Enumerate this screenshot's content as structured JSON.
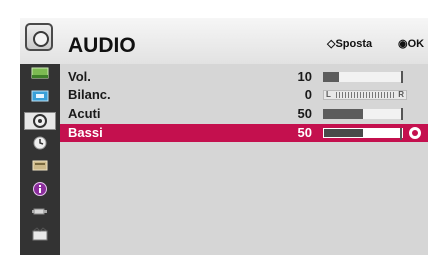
{
  "header": {
    "title": "AUDIO",
    "hint_move": "◇Sposta",
    "hint_ok": "◉OK",
    "icon": "audio-icon"
  },
  "sidebar": {
    "items": [
      {
        "icon": "picture-icon"
      },
      {
        "icon": "screen-icon"
      },
      {
        "icon": "audio-icon",
        "active": true
      },
      {
        "icon": "time-icon"
      },
      {
        "icon": "setup-icon"
      },
      {
        "icon": "info-icon"
      },
      {
        "icon": "input-icon"
      },
      {
        "icon": "movie-icon"
      }
    ]
  },
  "menu": {
    "rows": [
      {
        "label": "Vol.",
        "value": "10",
        "level": 0.2
      },
      {
        "label": "Bilanc.",
        "value": "0",
        "balance_left": "L",
        "balance_right": "R"
      },
      {
        "label": "Acuti",
        "value": "50",
        "level": 0.5
      },
      {
        "label": "Bassi",
        "value": "50",
        "level": 0.5,
        "selected": true
      }
    ]
  },
  "colors": {
    "selection": "#c4104e",
    "sidebar_bg": "#333333",
    "panel_bg": "#d6d6d6"
  }
}
